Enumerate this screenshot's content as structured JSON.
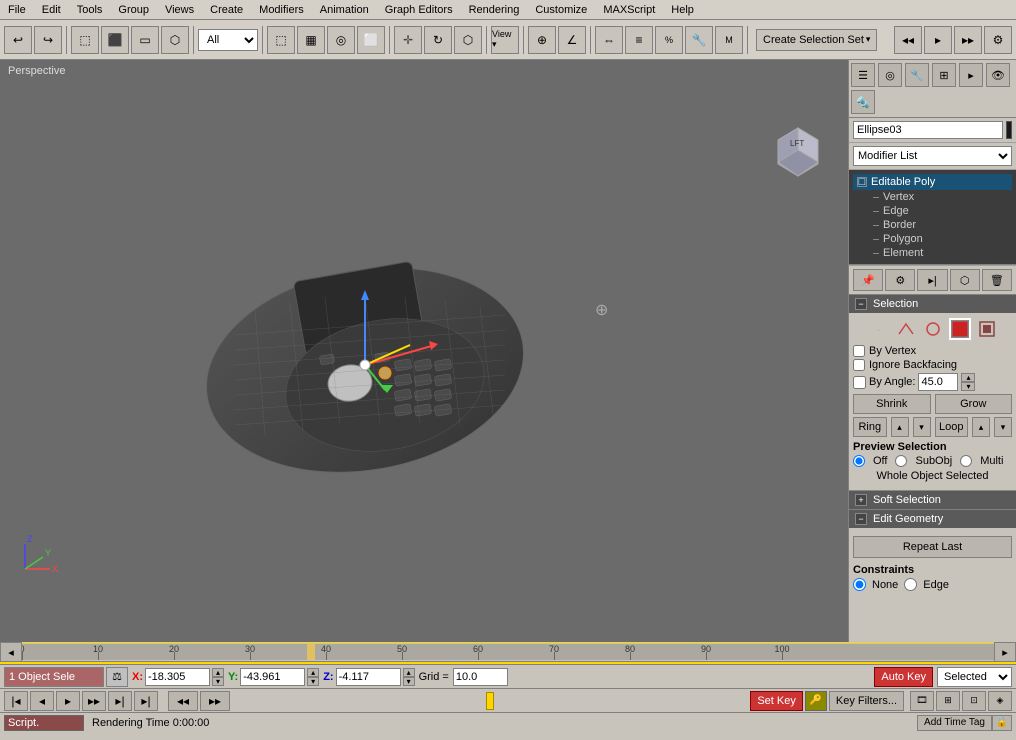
{
  "menu": {
    "items": [
      "File",
      "Edit",
      "Tools",
      "Group",
      "Views",
      "Create",
      "Modifiers",
      "Animation",
      "Graph Editors",
      "Rendering",
      "Customize",
      "MAXScript",
      "Help"
    ]
  },
  "toolbar": {
    "mode_dropdown": "All",
    "create_selection_set": "Create Selection Set",
    "nav_buttons": [
      "◂◂",
      "◂",
      "▸",
      "▸▸",
      "⟳"
    ]
  },
  "viewport": {
    "label": "Perspective",
    "cube_label": "LFT"
  },
  "right_panel": {
    "object_name": "Ellipse03",
    "modifier_list_label": "Modifier List",
    "modifier_stack": {
      "root": "Editable Poly",
      "items": [
        "Vertex",
        "Edge",
        "Border",
        "Polygon",
        "Element"
      ]
    },
    "selection": {
      "title": "Selection",
      "by_vertex": "By Vertex",
      "ignore_backfacing": "Ignore Backfacing",
      "by_angle_label": "By Angle:",
      "by_angle_value": "45.0",
      "shrink": "Shrink",
      "grow": "Grow",
      "ring": "Ring",
      "loop": "Loop",
      "preview_selection": "Preview Selection",
      "off": "Off",
      "subobj": "SubObj",
      "multi": "Multi",
      "whole_object_selected": "Whole Object Selected"
    },
    "soft_selection": {
      "title": "Soft Selection"
    },
    "edit_geometry": {
      "title": "Edit Geometry",
      "repeat_last": "Repeat Last",
      "constraints_label": "Constraints",
      "none": "None",
      "edge": "Edge"
    }
  },
  "bottom": {
    "object_select": "1 Object Sele",
    "x_label": "X:",
    "x_value": "-18.305",
    "y_label": "Y:",
    "y_value": "-43.961",
    "z_label": "Z:",
    "z_value": "-4.117",
    "grid_label": "Grid =",
    "grid_value": "10.0",
    "auto_key": "Auto Key",
    "selected_label": "Selected",
    "set_key": "Set Key",
    "key_filters": "Key Filters...",
    "frame_display": "38 / 100",
    "script_label": "Script.",
    "rendering_status": "Rendering Time  0:00:00",
    "add_time_tag": "Add Time Tag"
  },
  "icons": {
    "dot_icon": "·",
    "triangle_icon": "△",
    "circle_icon": "○",
    "square_icon": "□",
    "diamond_icon": "◇",
    "plus_icon": "+",
    "minus_icon": "−",
    "arrow_left": "◂",
    "arrow_right": "▸",
    "arrow_up": "▴",
    "arrow_down": "▾",
    "check": "✓"
  }
}
